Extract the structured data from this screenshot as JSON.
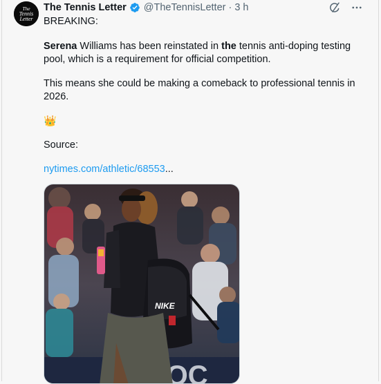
{
  "author": {
    "name": "The Tennis Letter",
    "handle": "@TheTennisLetter",
    "separator": "·",
    "time": "3 h",
    "verified": true,
    "avatar_text": [
      "The",
      "Tennis",
      "Letter"
    ]
  },
  "icons": {
    "verified": "verified-badge-icon",
    "grok": "grok-icon",
    "more": "more-options-icon",
    "crown": "crown-emoji"
  },
  "tweet": {
    "line1": "BREAKING:",
    "para1_bold1": "Serena",
    "para1_text1": " Williams has been reinstated in ",
    "para1_bold2": "the",
    "para1_text2": " tennis anti-doping testing pool, which is a requirement for official competition.",
    "para2": "This means she could be making a comeback to professional tennis in 2026.",
    "emoji": "👑",
    "source_label": "Source:",
    "link_text": "nytimes.com/athletic/68553",
    "link_ellipsis": "..."
  },
  "colors": {
    "accent": "#1d9bf0",
    "text": "#0f1419",
    "muted": "#536471",
    "background": "#f7f7f7"
  }
}
